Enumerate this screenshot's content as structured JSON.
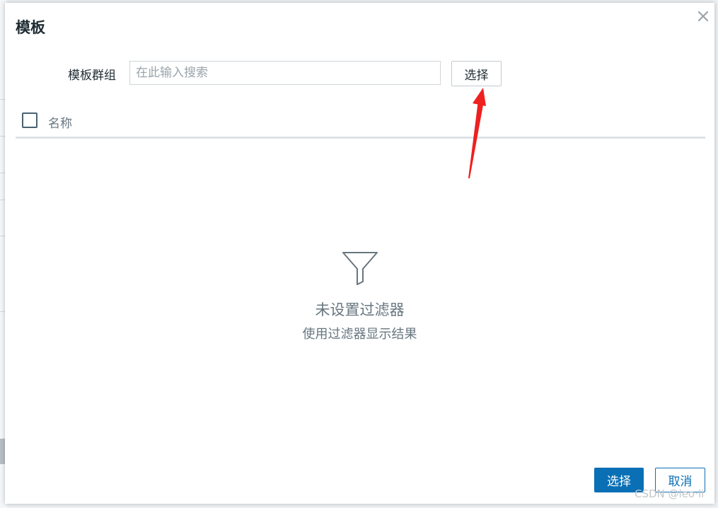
{
  "modal": {
    "title": "模板"
  },
  "filter": {
    "label": "模板群组",
    "input_value": "",
    "input_placeholder": "在此输入搜索",
    "select_label": "选择"
  },
  "table": {
    "columns": [
      "名称"
    ]
  },
  "empty_state": {
    "icon": "filter-funnel-icon",
    "title": "未设置过滤器",
    "subtitle": "使用过滤器显示结果"
  },
  "footer": {
    "primary_label": "选择",
    "cancel_label": "取消"
  },
  "watermark": "CSDN @leo·li",
  "colors": {
    "primary": "#0a6fb5",
    "annotation_arrow": "#ee2020",
    "text_muted": "#67767f"
  }
}
